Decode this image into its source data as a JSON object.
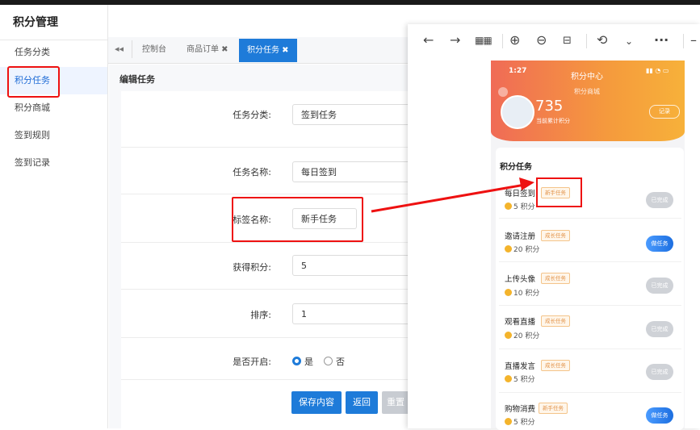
{
  "sidebar": {
    "title": "积分管理",
    "items": [
      {
        "label": "任务分类",
        "active": false
      },
      {
        "label": "积分任务",
        "active": true
      },
      {
        "label": "积分商城",
        "active": false
      },
      {
        "label": "签到规则",
        "active": false
      },
      {
        "label": "签到记录",
        "active": false
      }
    ]
  },
  "tabs": {
    "collapse_icon": "double-chevron-left-icon",
    "items": [
      {
        "label": "控制台"
      },
      {
        "label": "商品订单 ✖"
      },
      {
        "label": "积分任务 ✖",
        "active": true
      }
    ]
  },
  "form": {
    "title": "编辑任务",
    "fields": [
      {
        "label": "任务分类:",
        "value": "签到任务"
      },
      {
        "label": "任务名称:",
        "value": "每日签到"
      },
      {
        "label": "标签名称:",
        "value": "新手任务"
      },
      {
        "label": "获得积分:",
        "value": "5"
      },
      {
        "label": "排序:",
        "value": "1"
      }
    ],
    "enabled_label": "是否开启:",
    "radio_yes": "是",
    "radio_no": "否",
    "radio_selected": "是",
    "save_button": "保存内容",
    "back_button": "返回",
    "reset_button": "重置"
  },
  "phone": {
    "time": "1:27",
    "header_title": "积分中心",
    "header_sub": "积分商城",
    "points_total": "735",
    "points_label": "当前累计积分",
    "record_button": "记录",
    "section_title": "积分任务",
    "tasks": [
      {
        "name": "每日签到",
        "badge": "新手任务",
        "points": "5 积分",
        "action": "已完成",
        "done": true
      },
      {
        "name": "邀请注册",
        "badge": "成长任务",
        "points": "20 积分",
        "action": "做任务",
        "done": false
      },
      {
        "name": "上传头像",
        "badge": "成长任务",
        "points": "10 积分",
        "action": "已完成",
        "done": true
      },
      {
        "name": "观看直播",
        "badge": "成长任务",
        "points": "20 积分",
        "action": "已完成",
        "done": true
      },
      {
        "name": "直播发言",
        "badge": "成长任务",
        "points": "5 积分",
        "action": "已完成",
        "done": true
      },
      {
        "name": "购物消费",
        "badge": "新手任务",
        "points": "5 积分",
        "action": "做任务",
        "done": false
      }
    ]
  },
  "colors": {
    "accent": "#1e7bd9",
    "highlight_red": "#e11111",
    "header_gradient_start": "#f06b56",
    "header_gradient_end": "#f7b13a"
  }
}
